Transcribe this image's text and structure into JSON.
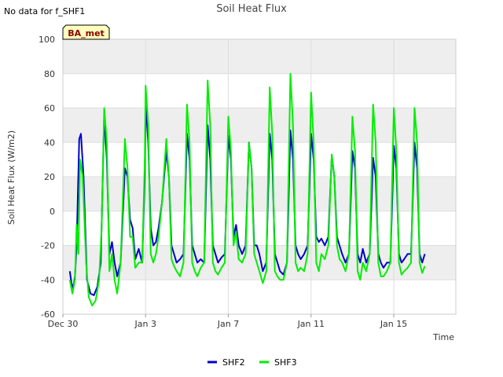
{
  "note": "No data for f_SHF1",
  "badge": "BA_met",
  "colors": {
    "band": "#eeeeee",
    "grid": "#dddddd",
    "badge_bg": "#ffffc0"
  },
  "chart_data": {
    "type": "line",
    "title": "Soil Heat Flux",
    "xlabel": "Time",
    "ylabel": "Soil Heat Flux (W/m2)",
    "xlim": [
      "2019-12-30",
      "2020-01-18"
    ],
    "ylim": [
      -60,
      100
    ],
    "yticks": [
      -60,
      -40,
      -20,
      0,
      20,
      40,
      60,
      80,
      100
    ],
    "xticks": [
      {
        "date": "2019-12-30",
        "label": "Dec 30"
      },
      {
        "date": "2020-01-03",
        "label": "Jan 3"
      },
      {
        "date": "2020-01-07",
        "label": "Jan 7"
      },
      {
        "date": "2020-01-11",
        "label": "Jan 11"
      },
      {
        "date": "2020-01-15",
        "label": "Jan 15"
      }
    ],
    "grid": true,
    "legend": "bottom",
    "series": [
      {
        "name": "SHF2",
        "color": "#0000cc",
        "points": [
          [
            "2019-12-30 08:00",
            -35
          ],
          [
            "2019-12-30 10:00",
            -42
          ],
          [
            "2019-12-30 12:00",
            -45
          ],
          [
            "2019-12-30 14:00",
            -38
          ],
          [
            "2019-12-30 16:00",
            -20
          ],
          [
            "2019-12-30 19:00",
            42
          ],
          [
            "2019-12-30 21:00",
            45
          ],
          [
            "2019-12-31 00:00",
            20
          ],
          [
            "2019-12-31 04:00",
            -40
          ],
          [
            "2019-12-31 08:00",
            -48
          ],
          [
            "2019-12-31 12:00",
            -49
          ],
          [
            "2019-12-31 16:00",
            -44
          ],
          [
            "2019-12-31 20:00",
            -30
          ],
          [
            "2020-01-01 00:00",
            56
          ],
          [
            "2020-01-01 03:00",
            30
          ],
          [
            "2020-01-01 06:00",
            -25
          ],
          [
            "2020-01-01 09:00",
            -18
          ],
          [
            "2020-01-01 12:00",
            -30
          ],
          [
            "2020-01-01 15:00",
            -38
          ],
          [
            "2020-01-01 19:00",
            -30
          ],
          [
            "2020-01-02 00:00",
            25
          ],
          [
            "2020-01-02 03:00",
            20
          ],
          [
            "2020-01-02 06:00",
            -5
          ],
          [
            "2020-01-02 09:00",
            -10
          ],
          [
            "2020-01-02 12:00",
            -28
          ],
          [
            "2020-01-02 16:00",
            -22
          ],
          [
            "2020-01-02 20:00",
            -30
          ],
          [
            "2020-01-02 23:00",
            20
          ],
          [
            "2020-01-03 00:00",
            63
          ],
          [
            "2020-01-03 03:00",
            40
          ],
          [
            "2020-01-03 06:00",
            -10
          ],
          [
            "2020-01-03 09:00",
            -20
          ],
          [
            "2020-01-03 12:00",
            -18
          ],
          [
            "2020-01-03 15:00",
            -10
          ],
          [
            "2020-01-03 19:00",
            5
          ],
          [
            "2020-01-04 00:00",
            35
          ],
          [
            "2020-01-04 03:00",
            20
          ],
          [
            "2020-01-04 06:00",
            -20
          ],
          [
            "2020-01-04 09:00",
            -25
          ],
          [
            "2020-01-04 12:00",
            -30
          ],
          [
            "2020-01-04 16:00",
            -28
          ],
          [
            "2020-01-04 20:00",
            -25
          ],
          [
            "2020-01-05 00:00",
            45
          ],
          [
            "2020-01-05 03:00",
            30
          ],
          [
            "2020-01-05 06:00",
            -20
          ],
          [
            "2020-01-05 09:00",
            -25
          ],
          [
            "2020-01-05 12:00",
            -30
          ],
          [
            "2020-01-05 16:00",
            -28
          ],
          [
            "2020-01-05 20:00",
            -30
          ],
          [
            "2020-01-06 00:00",
            50
          ],
          [
            "2020-01-06 03:00",
            30
          ],
          [
            "2020-01-06 06:00",
            -20
          ],
          [
            "2020-01-06 09:00",
            -25
          ],
          [
            "2020-01-06 12:00",
            -30
          ],
          [
            "2020-01-06 16:00",
            -27
          ],
          [
            "2020-01-06 20:00",
            -25
          ],
          [
            "2020-01-07 00:00",
            44
          ],
          [
            "2020-01-07 03:00",
            30
          ],
          [
            "2020-01-07 06:00",
            -15
          ],
          [
            "2020-01-07 09:00",
            -8
          ],
          [
            "2020-01-07 12:00",
            -20
          ],
          [
            "2020-01-07 16:00",
            -25
          ],
          [
            "2020-01-07 20:00",
            -20
          ],
          [
            "2020-01-08 00:00",
            40
          ],
          [
            "2020-01-08 03:00",
            25
          ],
          [
            "2020-01-08 06:00",
            -20
          ],
          [
            "2020-01-08 09:00",
            -20
          ],
          [
            "2020-01-08 12:00",
            -25
          ],
          [
            "2020-01-08 16:00",
            -35
          ],
          [
            "2020-01-08 20:00",
            -30
          ],
          [
            "2020-01-09 00:00",
            45
          ],
          [
            "2020-01-09 03:00",
            30
          ],
          [
            "2020-01-09 06:00",
            -25
          ],
          [
            "2020-01-09 09:00",
            -30
          ],
          [
            "2020-01-09 12:00",
            -35
          ],
          [
            "2020-01-09 16:00",
            -37
          ],
          [
            "2020-01-09 20:00",
            -30
          ],
          [
            "2020-01-10 00:00",
            47
          ],
          [
            "2020-01-10 03:00",
            30
          ],
          [
            "2020-01-10 06:00",
            -20
          ],
          [
            "2020-01-10 09:00",
            -25
          ],
          [
            "2020-01-10 12:00",
            -28
          ],
          [
            "2020-01-10 16:00",
            -25
          ],
          [
            "2020-01-10 20:00",
            -20
          ],
          [
            "2020-01-11 00:00",
            45
          ],
          [
            "2020-01-11 03:00",
            30
          ],
          [
            "2020-01-11 06:00",
            -15
          ],
          [
            "2020-01-11 09:00",
            -18
          ],
          [
            "2020-01-11 12:00",
            -16
          ],
          [
            "2020-01-11 16:00",
            -20
          ],
          [
            "2020-01-11 20:00",
            -15
          ],
          [
            "2020-01-12 00:00",
            32
          ],
          [
            "2020-01-12 03:00",
            20
          ],
          [
            "2020-01-12 06:00",
            -15
          ],
          [
            "2020-01-12 09:00",
            -20
          ],
          [
            "2020-01-12 12:00",
            -25
          ],
          [
            "2020-01-12 16:00",
            -30
          ],
          [
            "2020-01-12 20:00",
            -25
          ],
          [
            "2020-01-13 00:00",
            35
          ],
          [
            "2020-01-13 03:00",
            25
          ],
          [
            "2020-01-13 06:00",
            -25
          ],
          [
            "2020-01-13 09:00",
            -30
          ],
          [
            "2020-01-13 12:00",
            -22
          ],
          [
            "2020-01-13 16:00",
            -30
          ],
          [
            "2020-01-13 20:00",
            -25
          ],
          [
            "2020-01-14 00:00",
            31
          ],
          [
            "2020-01-14 03:00",
            20
          ],
          [
            "2020-01-14 06:00",
            -25
          ],
          [
            "2020-01-14 09:00",
            -30
          ],
          [
            "2020-01-14 12:00",
            -33
          ],
          [
            "2020-01-14 16:00",
            -30
          ],
          [
            "2020-01-14 20:00",
            -30
          ],
          [
            "2020-01-15 00:00",
            38
          ],
          [
            "2020-01-15 03:00",
            25
          ],
          [
            "2020-01-15 06:00",
            -25
          ],
          [
            "2020-01-15 09:00",
            -30
          ],
          [
            "2020-01-15 12:00",
            -28
          ],
          [
            "2020-01-15 16:00",
            -25
          ],
          [
            "2020-01-15 20:00",
            -25
          ],
          [
            "2020-01-16 00:00",
            40
          ],
          [
            "2020-01-16 03:00",
            25
          ],
          [
            "2020-01-16 06:00",
            -25
          ],
          [
            "2020-01-16 09:00",
            -30
          ],
          [
            "2020-01-16 12:00",
            -25
          ]
        ]
      },
      {
        "name": "SHF3",
        "color": "#00ee00",
        "points": [
          [
            "2019-12-30 08:00",
            -40
          ],
          [
            "2019-12-30 11:00",
            -48
          ],
          [
            "2019-12-30 14:00",
            -40
          ],
          [
            "2019-12-30 16:00",
            -8
          ],
          [
            "2019-12-30 18:00",
            -25
          ],
          [
            "2019-12-30 20:00",
            30
          ],
          [
            "2019-12-30 23:00",
            20
          ],
          [
            "2019-12-31 03:00",
            -30
          ],
          [
            "2019-12-31 06:00",
            -50
          ],
          [
            "2019-12-31 10:00",
            -55
          ],
          [
            "2019-12-31 14:00",
            -52
          ],
          [
            "2019-12-31 18:00",
            -40
          ],
          [
            "2019-12-31 21:00",
            -10
          ],
          [
            "2020-01-01 00:00",
            60
          ],
          [
            "2020-01-01 03:00",
            40
          ],
          [
            "2020-01-01 06:00",
            -35
          ],
          [
            "2020-01-01 09:00",
            -25
          ],
          [
            "2020-01-01 12:00",
            -40
          ],
          [
            "2020-01-01 15:00",
            -48
          ],
          [
            "2020-01-01 19:00",
            -30
          ],
          [
            "2020-01-02 00:00",
            42
          ],
          [
            "2020-01-02 03:00",
            25
          ],
          [
            "2020-01-02 06:00",
            -15
          ],
          [
            "2020-01-02 09:00",
            -15
          ],
          [
            "2020-01-02 12:00",
            -33
          ],
          [
            "2020-01-02 16:00",
            -30
          ],
          [
            "2020-01-02 20:00",
            -30
          ],
          [
            "2020-01-02 23:00",
            30
          ],
          [
            "2020-01-03 00:00",
            73
          ],
          [
            "2020-01-03 03:00",
            50
          ],
          [
            "2020-01-03 06:00",
            -25
          ],
          [
            "2020-01-03 09:00",
            -30
          ],
          [
            "2020-01-03 12:00",
            -25
          ],
          [
            "2020-01-03 15:00",
            -15
          ],
          [
            "2020-01-03 19:00",
            5
          ],
          [
            "2020-01-04 00:00",
            42
          ],
          [
            "2020-01-04 03:00",
            20
          ],
          [
            "2020-01-04 06:00",
            -28
          ],
          [
            "2020-01-04 09:00",
            -32
          ],
          [
            "2020-01-04 12:00",
            -35
          ],
          [
            "2020-01-04 16:00",
            -38
          ],
          [
            "2020-01-04 20:00",
            -30
          ],
          [
            "2020-01-05 00:00",
            62
          ],
          [
            "2020-01-05 03:00",
            40
          ],
          [
            "2020-01-05 06:00",
            -30
          ],
          [
            "2020-01-05 09:00",
            -35
          ],
          [
            "2020-01-05 12:00",
            -38
          ],
          [
            "2020-01-05 16:00",
            -33
          ],
          [
            "2020-01-05 20:00",
            -30
          ],
          [
            "2020-01-06 00:00",
            76
          ],
          [
            "2020-01-06 03:00",
            50
          ],
          [
            "2020-01-06 06:00",
            -30
          ],
          [
            "2020-01-06 09:00",
            -35
          ],
          [
            "2020-01-06 12:00",
            -37
          ],
          [
            "2020-01-06 16:00",
            -33
          ],
          [
            "2020-01-06 20:00",
            -30
          ],
          [
            "2020-01-07 00:00",
            55
          ],
          [
            "2020-01-07 03:00",
            35
          ],
          [
            "2020-01-07 06:00",
            -20
          ],
          [
            "2020-01-07 09:00",
            -12
          ],
          [
            "2020-01-07 12:00",
            -28
          ],
          [
            "2020-01-07 16:00",
            -30
          ],
          [
            "2020-01-07 20:00",
            -25
          ],
          [
            "2020-01-08 00:00",
            40
          ],
          [
            "2020-01-08 03:00",
            25
          ],
          [
            "2020-01-08 06:00",
            -25
          ],
          [
            "2020-01-08 09:00",
            -30
          ],
          [
            "2020-01-08 12:00",
            -35
          ],
          [
            "2020-01-08 16:00",
            -42
          ],
          [
            "2020-01-08 20:00",
            -35
          ],
          [
            "2020-01-09 00:00",
            72
          ],
          [
            "2020-01-09 03:00",
            45
          ],
          [
            "2020-01-09 06:00",
            -35
          ],
          [
            "2020-01-09 09:00",
            -38
          ],
          [
            "2020-01-09 12:00",
            -40
          ],
          [
            "2020-01-09 16:00",
            -40
          ],
          [
            "2020-01-09 20:00",
            -30
          ],
          [
            "2020-01-10 00:00",
            80
          ],
          [
            "2020-01-10 03:00",
            50
          ],
          [
            "2020-01-10 06:00",
            -30
          ],
          [
            "2020-01-10 09:00",
            -35
          ],
          [
            "2020-01-10 12:00",
            -33
          ],
          [
            "2020-01-10 16:00",
            -35
          ],
          [
            "2020-01-10 20:00",
            -25
          ],
          [
            "2020-01-11 00:00",
            69
          ],
          [
            "2020-01-11 03:00",
            40
          ],
          [
            "2020-01-11 06:00",
            -30
          ],
          [
            "2020-01-11 09:00",
            -35
          ],
          [
            "2020-01-11 12:00",
            -25
          ],
          [
            "2020-01-11 16:00",
            -28
          ],
          [
            "2020-01-11 20:00",
            -20
          ],
          [
            "2020-01-12 00:00",
            33
          ],
          [
            "2020-01-12 03:00",
            20
          ],
          [
            "2020-01-12 06:00",
            -20
          ],
          [
            "2020-01-12 09:00",
            -28
          ],
          [
            "2020-01-12 12:00",
            -30
          ],
          [
            "2020-01-12 16:00",
            -35
          ],
          [
            "2020-01-12 20:00",
            -25
          ],
          [
            "2020-01-13 00:00",
            55
          ],
          [
            "2020-01-13 03:00",
            35
          ],
          [
            "2020-01-13 06:00",
            -35
          ],
          [
            "2020-01-13 09:00",
            -40
          ],
          [
            "2020-01-13 12:00",
            -30
          ],
          [
            "2020-01-13 16:00",
            -35
          ],
          [
            "2020-01-13 20:00",
            -25
          ],
          [
            "2020-01-14 00:00",
            62
          ],
          [
            "2020-01-14 03:00",
            40
          ],
          [
            "2020-01-14 06:00",
            -30
          ],
          [
            "2020-01-14 09:00",
            -38
          ],
          [
            "2020-01-14 12:00",
            -38
          ],
          [
            "2020-01-14 16:00",
            -35
          ],
          [
            "2020-01-14 20:00",
            -30
          ],
          [
            "2020-01-15 00:00",
            60
          ],
          [
            "2020-01-15 03:00",
            35
          ],
          [
            "2020-01-15 06:00",
            -30
          ],
          [
            "2020-01-15 09:00",
            -37
          ],
          [
            "2020-01-15 12:00",
            -35
          ],
          [
            "2020-01-15 16:00",
            -33
          ],
          [
            "2020-01-15 20:00",
            -30
          ],
          [
            "2020-01-16 00:00",
            60
          ],
          [
            "2020-01-16 03:00",
            40
          ],
          [
            "2020-01-16 06:00",
            -30
          ],
          [
            "2020-01-16 09:00",
            -36
          ],
          [
            "2020-01-16 12:00",
            -32
          ]
        ]
      }
    ]
  }
}
